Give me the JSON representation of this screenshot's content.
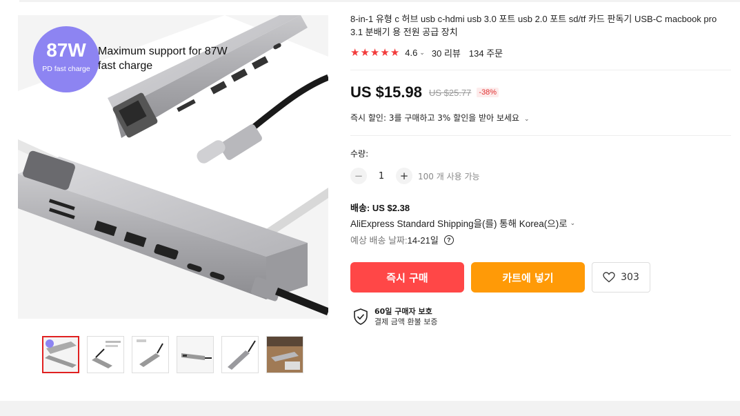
{
  "product": {
    "title": "8-in-1 유형 c 허브 usb c-hdmi usb 3.0 포트 usb 2.0 포트 sd/tf 카드 판독기 USB-C macbook pro 3.1 분배기 용 전원 공급 장치",
    "rating": "4.6",
    "stars": 5,
    "reviews": "30 리뷰",
    "orders": "134 주문",
    "image_badge": {
      "value": "87W",
      "sub": "PD fast charge",
      "caption": "Maximum support for 87W fast charge"
    },
    "thumbnail_count": 6
  },
  "price": {
    "current": "US $15.98",
    "original": "US $25.77",
    "discount": "-38%"
  },
  "instant_discount": "즉시 할인: 3를 구매하고 3% 할인을 받아 보세요",
  "quantity": {
    "label": "수량:",
    "value": "1",
    "minus": "−",
    "plus": "+",
    "available": "100 개 사용 가능"
  },
  "shipping": {
    "price": "배송: US $2.38",
    "method": "AliExpress Standard Shipping을(를) 통해 Korea(으)로",
    "date_label": "예상 배송 날짜: ",
    "date_value": "14-21일",
    "help": "?"
  },
  "actions": {
    "buy_now": "즉시 구매",
    "add_to_cart": "카트에 넣기",
    "wishlist_count": "303"
  },
  "protection": {
    "title": "60일 구매자 보호",
    "subtitle": "결제 금액 환불 보증"
  },
  "colors": {
    "accent_red": "#ff4747",
    "accent_orange": "#ff9a07",
    "star": "#f23c3c",
    "badge_purple": "#8d84f2"
  }
}
